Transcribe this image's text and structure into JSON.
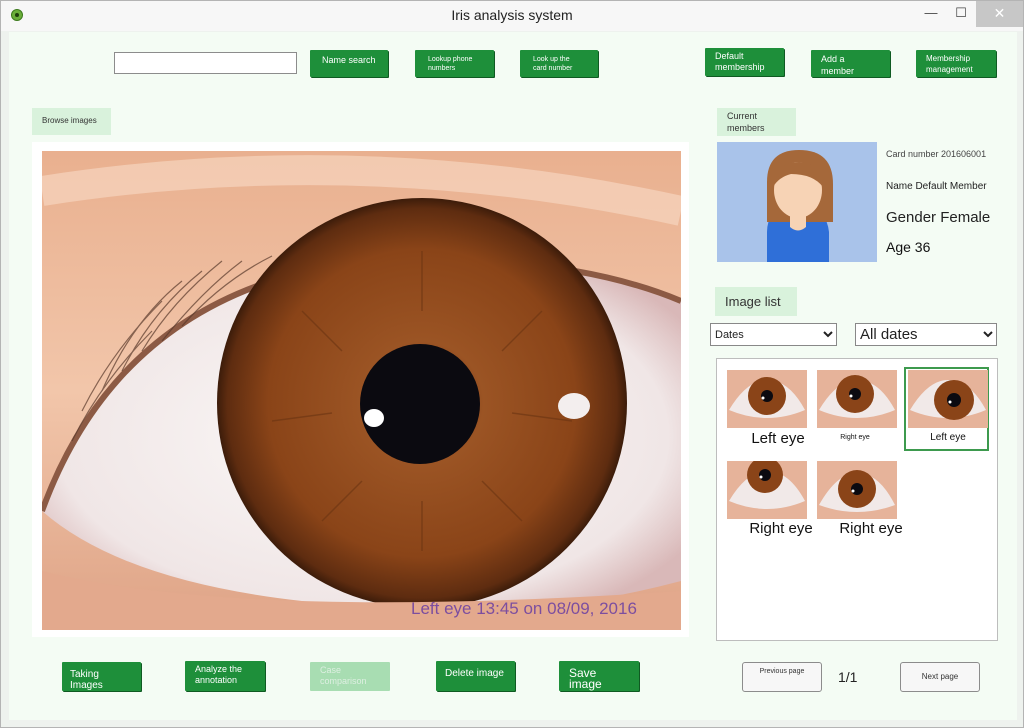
{
  "window": {
    "title": "Iris analysis system",
    "min": "—",
    "max": "☐",
    "close": "✕"
  },
  "toolbar": {
    "search_value": "",
    "name_search": "Name search",
    "lookup_phone": "Lookup phone numbers",
    "lookup_card": "Look up the card number",
    "default_membership": "Default membership",
    "add_member": "Add a member",
    "membership_management": "Membership management"
  },
  "viewer": {
    "browse_images": "Browse images",
    "caption": "Left eye 13:45 on 08/09, 2016"
  },
  "actions": {
    "taking_images": "Taking Images",
    "analyze_annotation": "Analyze the annotation",
    "case_comparison": "Case comparison",
    "delete_image": "Delete image",
    "save_image": "Save image"
  },
  "member": {
    "header": "Current members",
    "card_number": "Card number 201606001",
    "name": "Name Default Member",
    "gender": "Gender Female",
    "age": "Age 36"
  },
  "image_list": {
    "header": "Image list",
    "filter_type": "Dates",
    "filter_value": "All dates",
    "thumbnails": [
      {
        "label": "Left eye"
      },
      {
        "label": "Right eye"
      },
      {
        "label": "Left eye",
        "selected": true
      },
      {
        "label": "Right eye"
      },
      {
        "label": "Right eye"
      }
    ]
  },
  "pagination": {
    "previous": "Previous page",
    "indicator": "1/1",
    "next": "Next page"
  },
  "colors": {
    "accent": "#1e8f3a",
    "light_accent": "#d9f2dc",
    "background": "#f4fcf4",
    "iris": "#8a4418"
  }
}
